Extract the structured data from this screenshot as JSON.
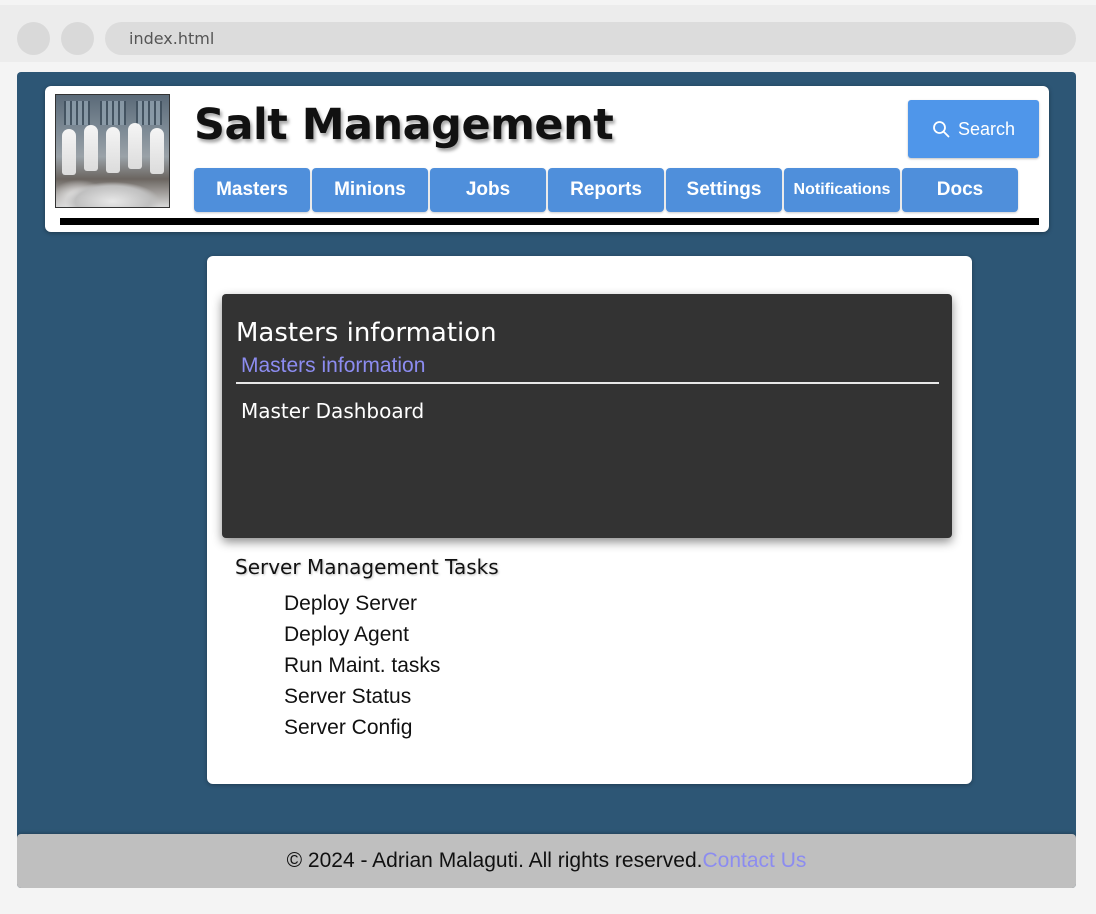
{
  "browser": {
    "url": "index.html"
  },
  "header": {
    "title": "Salt Management",
    "search_label": "Search",
    "nav": [
      {
        "label": "Masters"
      },
      {
        "label": "Minions"
      },
      {
        "label": "Jobs"
      },
      {
        "label": "Reports"
      },
      {
        "label": "Settings"
      },
      {
        "label": "Notifications"
      },
      {
        "label": "Docs"
      }
    ]
  },
  "panel": {
    "title": "Masters information",
    "subtitle": "Masters information",
    "dashboard": "Master Dashboard"
  },
  "tasks": {
    "title": "Server Management Tasks",
    "items": [
      "Deploy Server",
      "Deploy Agent",
      "Run Maint. tasks",
      "Server Status",
      "Server Config"
    ]
  },
  "footer": {
    "copyright": "© 2024 - Adrian Malaguti. All rights reserved.",
    "contact": "Contact Us"
  },
  "colors": {
    "page_bg": "#2d5675",
    "nav_button": "#4f8fdb",
    "search_button": "#4f96ea",
    "panel_bg": "#333333",
    "link": "#8c8cf0"
  }
}
